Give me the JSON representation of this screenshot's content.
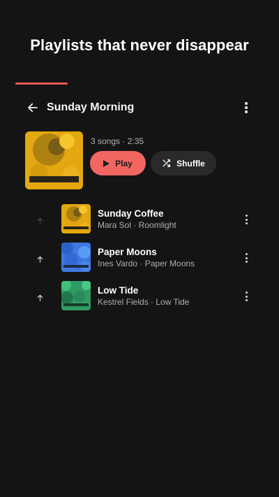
{
  "headline": "Playlists that never disappear",
  "colors": {
    "background": "#141414",
    "accent": "#ef5a55",
    "play_button": "#f26662",
    "shuffle_button": "#2a2a2a",
    "cover_yellow": "#e3a711",
    "cover_blue": "#3f78e0",
    "cover_green": "#2f9a63"
  },
  "topbar": {
    "back_icon": "arrow-left-icon",
    "title": "Sunday Morning",
    "more_icon": "more-vertical-icon"
  },
  "playlist": {
    "meta": "3 songs · 2:35",
    "play_label": "Play",
    "play_icon": "play-icon",
    "shuffle_label": "Shuffle",
    "shuffle_icon": "shuffle-icon"
  },
  "tracks": [
    {
      "title": "Sunday Coffee",
      "subtitle": "Mara Sol · Roomlight",
      "cover": "yellow",
      "move_up_enabled": false
    },
    {
      "title": "Paper Moons",
      "subtitle": "Ines Vardo · Paper Moons",
      "cover": "blue",
      "move_up_enabled": true
    },
    {
      "title": "Low Tide",
      "subtitle": "Kestrel Fields · Low Tide",
      "cover": "green",
      "move_up_enabled": true
    }
  ]
}
